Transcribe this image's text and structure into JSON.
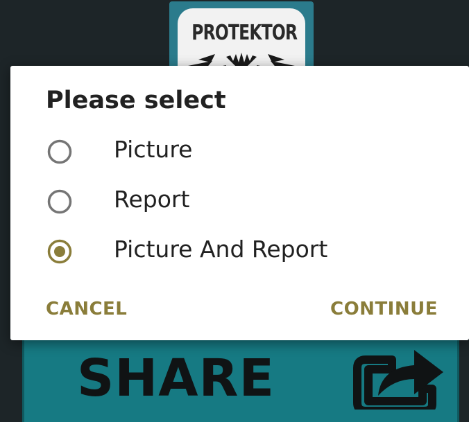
{
  "background": {
    "logo_text": "PROTEKTOR",
    "share_label": "SHARE",
    "share_icon": "share-arrow-icon"
  },
  "dialog": {
    "title": "Please select",
    "options": [
      {
        "label": "Picture",
        "selected": false
      },
      {
        "label": "Report",
        "selected": false
      },
      {
        "label": "Picture And Report",
        "selected": true
      }
    ],
    "cancel_label": "CANCEL",
    "continue_label": "CONTINUE"
  },
  "colors": {
    "accent": "#8a7d3a",
    "radio_unselected": "#757575",
    "text": "#212121",
    "share_bg": "#167a83"
  }
}
